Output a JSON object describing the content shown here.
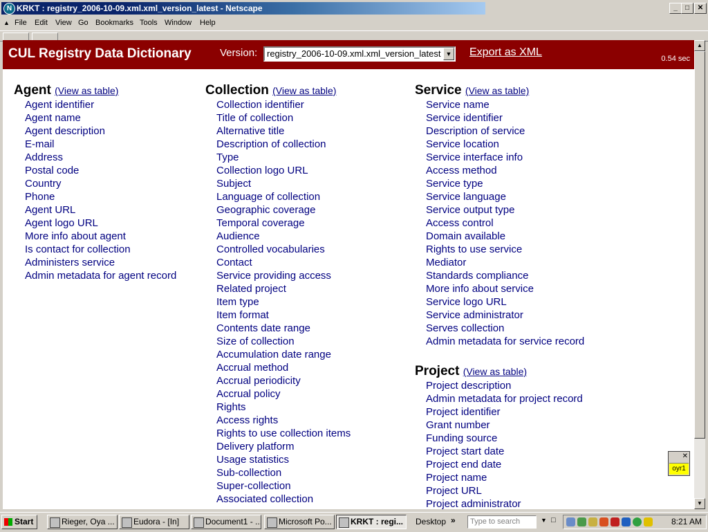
{
  "window": {
    "title": "KRKT : registry_2006-10-09.xml.xml_version_latest - Netscape",
    "buttons": {
      "minimize": "_",
      "maximize": "□",
      "close": "✕"
    }
  },
  "menu": [
    "File",
    "Edit",
    "View",
    "Go",
    "Bookmarks",
    "Tools",
    "Window",
    "Help"
  ],
  "header": {
    "title": "CUL Registry Data Dictionary",
    "version_label": "Version:",
    "version_value": "registry_2006-10-09.xml.xml_version_latest",
    "export_link": "Export as XML",
    "timing": "0.54 sec"
  },
  "sections": {
    "agent": {
      "name": "Agent",
      "table_link": "(View as table)",
      "fields": [
        "Agent identifier",
        "Agent name",
        "Agent description",
        "E-mail",
        "Address",
        "Postal code",
        "Country",
        "Phone",
        "Agent URL",
        "Agent logo URL",
        "More info about agent",
        "Is contact for collection",
        "Administers service",
        "Admin metadata for agent record"
      ]
    },
    "collection": {
      "name": "Collection",
      "table_link": "(View as table)",
      "fields": [
        "Collection identifier",
        "Title of collection",
        "Alternative title",
        "Description of collection",
        "Type",
        "Collection logo URL",
        "Subject",
        "Language of collection",
        "Geographic coverage",
        "Temporal coverage",
        "Audience",
        "Controlled vocabularies",
        "Contact",
        "Service providing access",
        "Related project",
        "Item type",
        "Item format",
        "Contents date range",
        "Size of collection",
        "Accumulation date range",
        "Accrual method",
        "Accrual periodicity",
        "Accrual policy",
        "Rights",
        "Access rights",
        "Rights to use collection items",
        "Delivery platform",
        "Usage statistics",
        "Sub-collection",
        "Super-collection",
        "Associated collection"
      ]
    },
    "service": {
      "name": "Service",
      "table_link": "(View as table)",
      "fields": [
        "Service name",
        "Service identifier",
        "Description of service",
        "Service location",
        "Service interface info",
        "Access method",
        "Service type",
        "Service language",
        "Service output type",
        "Access control",
        "Domain available",
        "Rights to use service",
        "Mediator",
        "Standards compliance",
        "More info about service",
        "Service logo URL",
        "Service administrator",
        "Serves collection",
        "Admin metadata for service record"
      ]
    },
    "project": {
      "name": "Project",
      "table_link": "(View as table)",
      "fields": [
        "Project description",
        "Admin metadata for project record",
        "Project identifier",
        "Grant number",
        "Funding source",
        "Project start date",
        "Project end date",
        "Project name",
        "Project URL",
        "Project administrator"
      ]
    }
  },
  "sticky_note": {
    "label": "oyr1",
    "close": "✕"
  },
  "taskbar": {
    "start": "Start",
    "tasks": [
      "Rieger, Oya ...",
      "Eudora - [In]",
      "Document1 - ...",
      "Microsoft Po...",
      "KRKT : regi..."
    ],
    "active_task": 4,
    "desktop": "Desktop",
    "chevron": "»",
    "search_placeholder": "Type to search",
    "clock": "8:21 AM"
  },
  "colors": {
    "banner": "#8b0000",
    "link": "#000080",
    "titlebar": "#0a246a"
  }
}
